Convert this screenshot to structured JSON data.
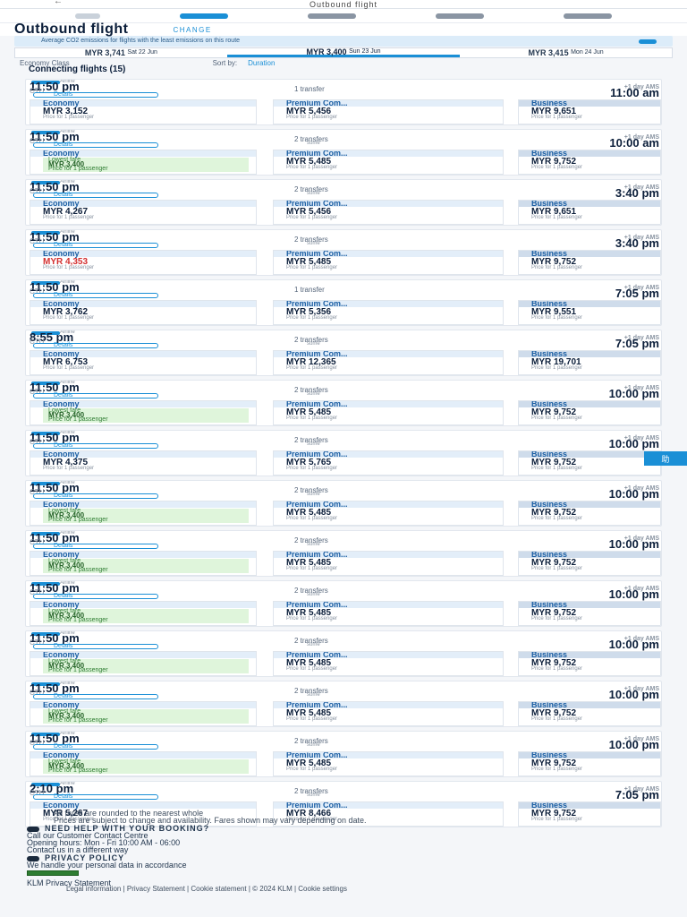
{
  "header": {
    "back": "←",
    "title": "Outbound flight"
  },
  "heading": {
    "title": "Outbound flight",
    "change": "CHANGE"
  },
  "co2_banner": {
    "text": "Average CO2 emissions for flights with the least emissions on this route"
  },
  "dates": [
    {
      "price": "MYR 3,741",
      "date": "Sat 22 Jun"
    },
    {
      "price": "MYR 3,400",
      "date": "Sun 23 Jun"
    },
    {
      "price": "MYR 3,415",
      "date": "Mon 24 Jun"
    }
  ],
  "filters": {
    "cabin": "Economy Class",
    "sort_label": "Sort by:",
    "sort_value": "Duration"
  },
  "connecting_label": "Connecting flights (15)",
  "common": {
    "details": "Details",
    "economy": "Economy",
    "premium": "Premium Com...",
    "business": "Business",
    "per_pax": "Price for 1 passenger",
    "lowest": "Lowest fare",
    "from": "From"
  },
  "flights": [
    {
      "operator": "Airline",
      "dep": "11:50 pm",
      "orig": "CTU",
      "transfers": "1 transfer",
      "via": "",
      "arr": "11:00 am",
      "dest": "+1 day AMS",
      "eco": "MYR 3,152",
      "pre": "MYR 5,456",
      "biz": "MYR 9,651",
      "promo": false
    },
    {
      "operator": "Airline",
      "dep": "11:50 pm",
      "orig": "CTU",
      "transfers": "2 transfers",
      "via": "some",
      "arr": "10:00 am",
      "dest": "+1 day AMS",
      "eco": "MYR 3,400",
      "pre": "MYR 5,485",
      "biz": "MYR 9,752",
      "promo": true
    },
    {
      "operator": "Airline",
      "dep": "11:50 pm",
      "orig": "CTU",
      "transfers": "2 transfers",
      "via": "some",
      "arr": "3:40 pm",
      "dest": "+1 day AMS",
      "eco": "MYR 4,267",
      "pre": "MYR 5,456",
      "biz": "MYR 9,651",
      "promo": false
    },
    {
      "operator": "Airline",
      "dep": "11:50 pm",
      "orig": "CTU",
      "transfers": "2 transfers",
      "via": "some",
      "arr": "3:40 pm",
      "dest": "+1 day AMS",
      "eco": "MYR 4,353",
      "pre": "MYR 5,485",
      "biz": "MYR 9,752",
      "promo": false,
      "red": true
    },
    {
      "operator": "Airline",
      "dep": "11:50 pm",
      "orig": "CTU",
      "transfers": "1 transfer",
      "via": "",
      "arr": "7:05 pm",
      "dest": "+1 day AMS",
      "eco": "MYR 3,762",
      "pre": "MYR 5,356",
      "biz": "MYR 9,551",
      "promo": false
    },
    {
      "operator": "Airline",
      "dep": "8:55 pm",
      "orig": "CTU",
      "transfers": "2 transfers",
      "via": "some",
      "arr": "7:05 pm",
      "dest": "+1 day AMS",
      "eco": "MYR 6,753",
      "pre": "MYR 12,365",
      "biz": "MYR 19,701",
      "promo": false
    },
    {
      "operator": "Airline",
      "dep": "11:50 pm",
      "orig": "CTU",
      "transfers": "2 transfers",
      "via": "some",
      "arr": "10:00 pm",
      "dest": "+1 day AMS",
      "eco": "MYR 3,400",
      "pre": "MYR 5,485",
      "biz": "MYR 9,752",
      "promo": true
    },
    {
      "operator": "Airline",
      "dep": "11:50 pm",
      "orig": "CTU",
      "transfers": "2 transfers",
      "via": "some",
      "arr": "10:00 pm",
      "dest": "+1 day AMS",
      "eco": "MYR 4,375",
      "pre": "MYR 5,765",
      "biz": "MYR 9,752",
      "promo": false
    },
    {
      "operator": "Airline",
      "dep": "11:50 pm",
      "orig": "CTU",
      "transfers": "2 transfers",
      "via": "some",
      "arr": "10:00 pm",
      "dest": "+1 day AMS",
      "eco": "MYR 3,400",
      "pre": "MYR 5,485",
      "biz": "MYR 9,752",
      "promo": true
    },
    {
      "operator": "Airline",
      "dep": "11:50 pm",
      "orig": "CTU",
      "transfers": "2 transfers",
      "via": "some",
      "arr": "10:00 pm",
      "dest": "+1 day AMS",
      "eco": "MYR 3,400",
      "pre": "MYR 5,485",
      "biz": "MYR 9,752",
      "promo": true
    },
    {
      "operator": "Airline",
      "dep": "11:50 pm",
      "orig": "CTU",
      "transfers": "2 transfers",
      "via": "some",
      "arr": "10:00 pm",
      "dest": "+1 day AMS",
      "eco": "MYR 3,400",
      "pre": "MYR 5,485",
      "biz": "MYR 9,752",
      "promo": true
    },
    {
      "operator": "Airline",
      "dep": "11:50 pm",
      "orig": "CTU",
      "transfers": "2 transfers",
      "via": "some",
      "arr": "10:00 pm",
      "dest": "+1 day AMS",
      "eco": "MYR 3,400",
      "pre": "MYR 5,485",
      "biz": "MYR 9,752",
      "promo": true
    },
    {
      "operator": "Airline",
      "dep": "11:50 pm",
      "orig": "CTU",
      "transfers": "2 transfers",
      "via": "some",
      "arr": "10:00 pm",
      "dest": "+1 day AMS",
      "eco": "MYR 3,400",
      "pre": "MYR 5,485",
      "biz": "MYR 9,752",
      "promo": true
    },
    {
      "operator": "Airline",
      "dep": "11:50 pm",
      "orig": "CTU",
      "transfers": "2 transfers",
      "via": "some",
      "arr": "10:00 pm",
      "dest": "+1 day AMS",
      "eco": "MYR 3,400",
      "pre": "MYR 5,485",
      "biz": "MYR 9,752",
      "promo": true
    },
    {
      "operator": "Airline",
      "dep": "2:10 pm",
      "orig": "CTU",
      "transfers": "2 transfers",
      "via": "some",
      "arr": "7:05 pm",
      "dest": "+1 day AMS",
      "eco": "MYR 5,267",
      "pre": "MYR 8,466",
      "biz": "MYR 9,752",
      "promo": false
    }
  ],
  "side_tab": "助",
  "footer": {
    "note1": "All fares are rounded to the nearest whole",
    "note2": "Prices are subject to change and availability. Fares shown may vary depending on date.",
    "help": "NEED HELP WITH YOUR BOOKING?",
    "contact1": "Call our Customer Contact Centre",
    "contact2": "Opening hours: Mon - Fri 10:00 AM - 06:00",
    "contact3": "Contact us in a different way",
    "privacy_h": "PRIVACY POLICY",
    "privacy_t": "We handle your personal data in accordance",
    "badge": "",
    "statement": "KLM Privacy Statement",
    "legal1": "Legal information",
    "legal2": "Privacy Statement",
    "legal3": "Cookie statement",
    "legal4": "© 2024 KLM",
    "legal5": "Cookie settings"
  }
}
